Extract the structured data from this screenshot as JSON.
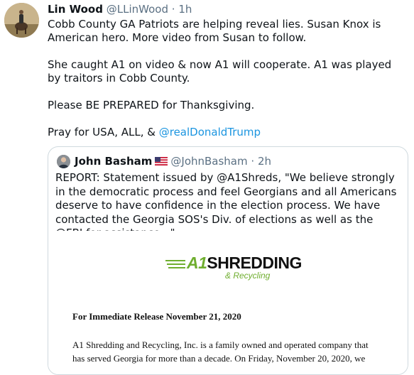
{
  "tweet": {
    "author_name": "Lin Wood",
    "author_handle": "@LLinWood",
    "separator": "·",
    "time": "1h",
    "lines": [
      "Cobb County GA Patriots are helping reveal lies. Susan Knox is American hero. More video from Susan to follow.",
      "She caught A1 on video & now A1 will cooperate. A1 was played by traitors in Cobb County.",
      "Please BE PREPARED for Thanksgiving."
    ],
    "last_line_prefix": "Pray for USA, ALL, & ",
    "last_line_mention": "@realDonaldTrump"
  },
  "quoted": {
    "author_name": "John Basham",
    "author_handle": "@JohnBasham",
    "separator": "·",
    "time": "2h",
    "text": "REPORT: Statement issued by @A1Shreds, \"We believe strongly in the democratic process and feel Georgians and all Americans deserve to have confidence in the election process. We have contacted the Georgia SOS's Div. of elections as well as the @FBI for assistance...\"",
    "document": {
      "logo_a1": "A1",
      "logo_word": "SHREDDING",
      "logo_sub": "& Recycling",
      "title": "For Immediate Release November 21, 2020",
      "line1": "A1 Shredding and Recycling, Inc. is a family owned and operated company that",
      "line2": "has served Georgia for more than a decade.  On Friday, November 20, 2020, we"
    }
  },
  "colors": {
    "link": "#1b95e0",
    "secondary_text": "#5b7083",
    "border": "#cfd9de",
    "logo_green": "#6fae2f"
  },
  "icons": {
    "author_avatar": "avatar-photo",
    "quoted_avatar": "avatar-photo",
    "flag": "us-flag-icon"
  }
}
